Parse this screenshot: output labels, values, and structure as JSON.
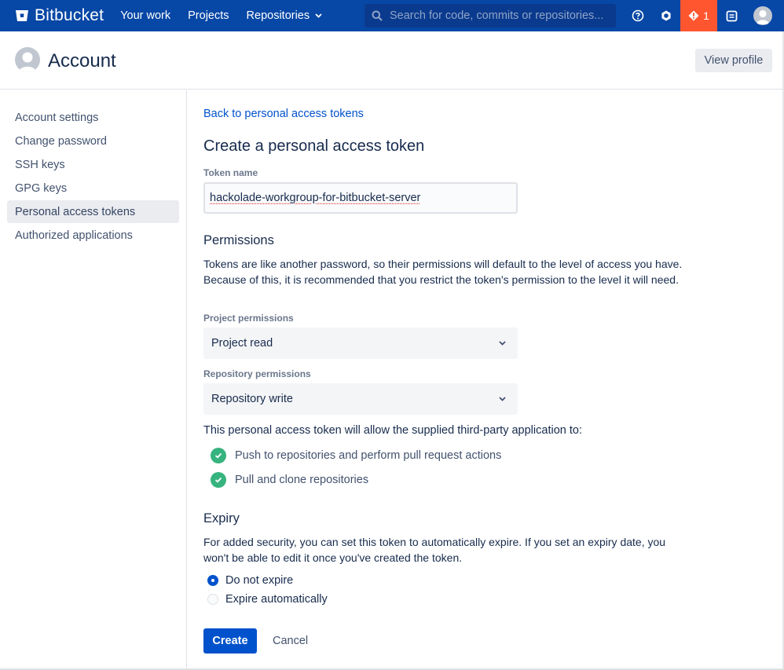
{
  "topnav": {
    "brand": "Bitbucket",
    "links": [
      {
        "label": "Your work"
      },
      {
        "label": "Projects"
      },
      {
        "label": "Repositories",
        "has_dropdown": true
      }
    ],
    "search": {
      "placeholder": "Search for code, commits or repositories...",
      "value": ""
    },
    "alert_count": "1",
    "icons": [
      "help-icon",
      "settings-gear-icon",
      "alert-icon",
      "notes-icon",
      "user-avatar"
    ],
    "colors": {
      "nav_bg": "#0747a6",
      "alert_bg": "#ff5630"
    }
  },
  "header": {
    "title": "Account",
    "view_profile_label": "View profile"
  },
  "sidebar": {
    "items": [
      {
        "label": "Account settings",
        "active": false
      },
      {
        "label": "Change password",
        "active": false
      },
      {
        "label": "SSH keys",
        "active": false
      },
      {
        "label": "GPG keys",
        "active": false
      },
      {
        "label": "Personal access tokens",
        "active": true
      },
      {
        "label": "Authorized applications",
        "active": false
      }
    ]
  },
  "main": {
    "back_link": "Back to personal access tokens",
    "title": "Create a personal access token",
    "token_name": {
      "label": "Token name",
      "value": "hackolade-workgroup-for-bitbucket-server"
    },
    "permissions": {
      "heading": "Permissions",
      "description": "Tokens are like another password, so their permissions will default to the level of access you have. Because of this, it is recommended that you restrict the token's permission to the level it will need.",
      "project": {
        "label": "Project permissions",
        "selected": "Project read"
      },
      "repository": {
        "label": "Repository permissions",
        "selected": "Repository write"
      },
      "allow_intro": "This personal access token will allow the supplied third-party application to:",
      "allowed": [
        "Push to repositories and perform pull request actions",
        "Pull and clone repositories"
      ]
    },
    "expiry": {
      "heading": "Expiry",
      "description": "For added security, you can set this token to automatically expire. If you set an expiry date, you won't be able to edit it once you've created the token.",
      "options": [
        {
          "label": "Do not expire",
          "selected": true
        },
        {
          "label": "Expire automatically",
          "selected": false
        }
      ]
    },
    "create_label": "Create",
    "cancel_label": "Cancel",
    "colors": {
      "primary": "#0052cc",
      "success": "#36b37e"
    }
  }
}
